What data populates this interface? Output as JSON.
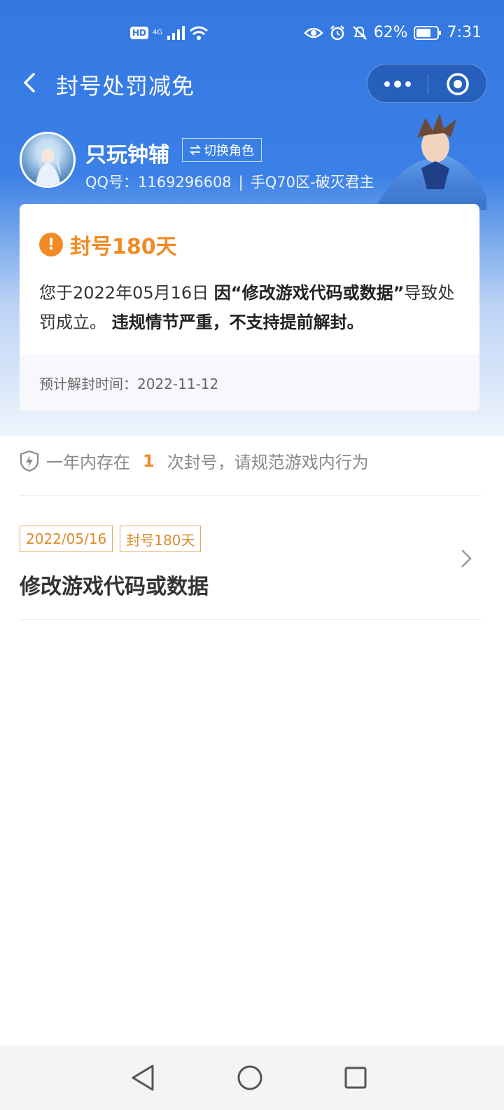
{
  "status_bar": {
    "hd": "HD",
    "network": "4G",
    "battery": "62%",
    "time": "7:31"
  },
  "header": {
    "title": "封号处罚减免"
  },
  "profile": {
    "name": "只玩钟辅",
    "switch_label": "切换角色",
    "qq_label": "QQ号：1169296608",
    "separator": "|",
    "server": "手Q70区-破灭君主"
  },
  "ban_card": {
    "title": "封号180天",
    "desc_prefix": "您于2022年05月16日 ",
    "desc_reason": "因“修改游戏代码或数据”",
    "desc_mid": "导致处罚成立。 ",
    "desc_severe": "违规情节严重，不支持提前解封。",
    "unban_time": "预计解封时间：2022-11-12"
  },
  "notice": {
    "prefix": "一年内存在",
    "count": "1",
    "suffix": "次封号，请规范游戏内行为"
  },
  "records": [
    {
      "date_tag": "2022/05/16",
      "duration_tag": "封号180天",
      "title": "修改游戏代码或数据"
    }
  ],
  "colors": {
    "brand_blue": "#3478e2",
    "accent_orange": "#f08a24"
  }
}
